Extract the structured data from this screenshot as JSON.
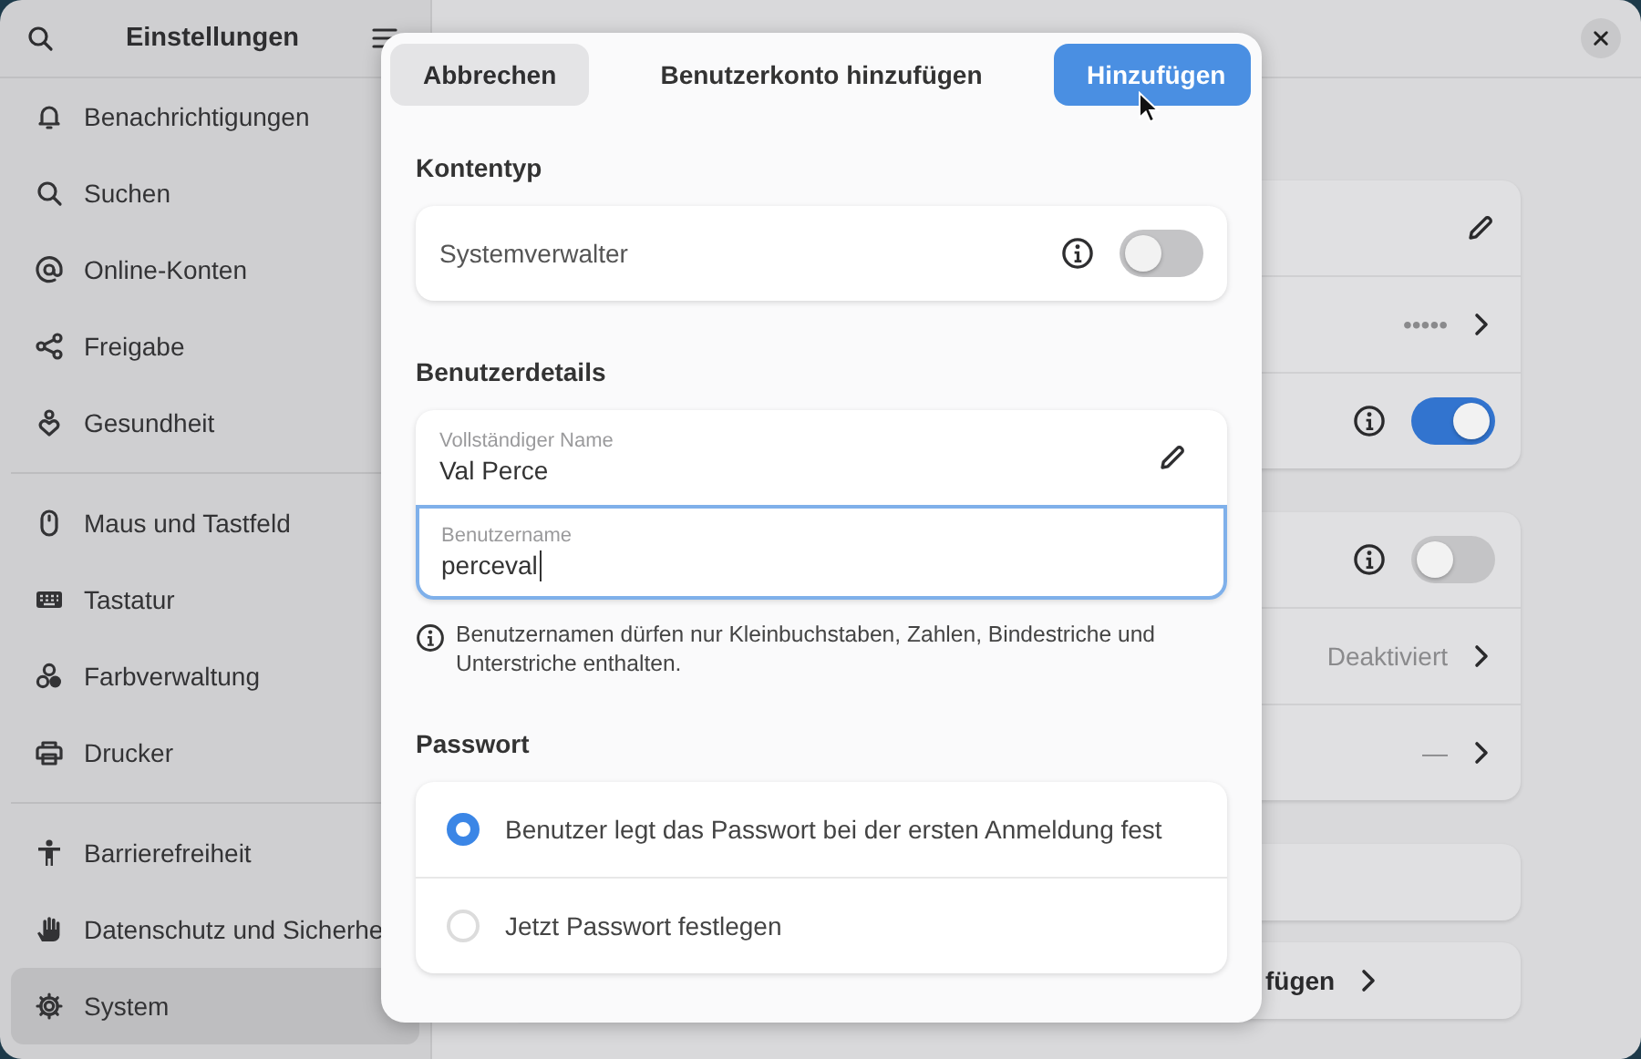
{
  "sidebar": {
    "title": "Einstellungen",
    "sections": [
      {
        "items": [
          {
            "label": "Benachrichtigungen",
            "selected": false
          },
          {
            "label": "Suchen",
            "selected": false
          },
          {
            "label": "Online-Konten",
            "selected": false
          },
          {
            "label": "Freigabe",
            "selected": false
          },
          {
            "label": "Gesundheit",
            "selected": false
          }
        ]
      },
      {
        "items": [
          {
            "label": "Maus und Tastfeld",
            "selected": false
          },
          {
            "label": "Tastatur",
            "selected": false
          },
          {
            "label": "Farbverwaltung",
            "selected": false
          },
          {
            "label": "Drucker",
            "selected": false
          }
        ]
      },
      {
        "items": [
          {
            "label": "Barrierefreiheit",
            "selected": false
          },
          {
            "label": "Datenschutz und Sicherhe",
            "selected": false
          },
          {
            "label": "System",
            "selected": true
          }
        ]
      }
    ]
  },
  "page": {
    "cards": [
      {
        "rows": [
          {
            "kind": "edit"
          },
          {
            "kind": "link",
            "value": "•••••"
          },
          {
            "kind": "toggle",
            "on": true
          }
        ]
      },
      {
        "rows": [
          {
            "kind": "toggle",
            "on": false
          },
          {
            "kind": "link",
            "value": "Deaktiviert"
          },
          {
            "kind": "link",
            "value": "—"
          }
        ]
      },
      {
        "rows": [
          {
            "kind": "blank"
          }
        ]
      },
      {
        "rows": [
          {
            "kind": "action",
            "label": "fügen"
          }
        ]
      }
    ]
  },
  "dialog": {
    "title": "Benutzerkonto hinzufügen",
    "cancel_button": "Abbrechen",
    "confirm_button": "Hinzufügen",
    "account_type": {
      "heading": "Kontentyp",
      "label": "Systemverwalter",
      "on": false
    },
    "user_details": {
      "heading": "Benutzerdetails",
      "fields": [
        {
          "label": "Vollständiger Name",
          "value": "Val Perce",
          "focused": false
        },
        {
          "label": "Benutzername",
          "value": "perceval",
          "focused": true
        }
      ],
      "hint": "Benutzernamen dürfen nur Kleinbuchstaben, Zahlen, Bindestriche und Unterstriche enthalten."
    },
    "password": {
      "heading": "Passwort",
      "options": [
        {
          "label": "Benutzer legt das Passwort bei der ersten Anmeldung fest",
          "selected": true
        },
        {
          "label": "Jetzt Passwort festlegen",
          "selected": false
        }
      ]
    }
  }
}
